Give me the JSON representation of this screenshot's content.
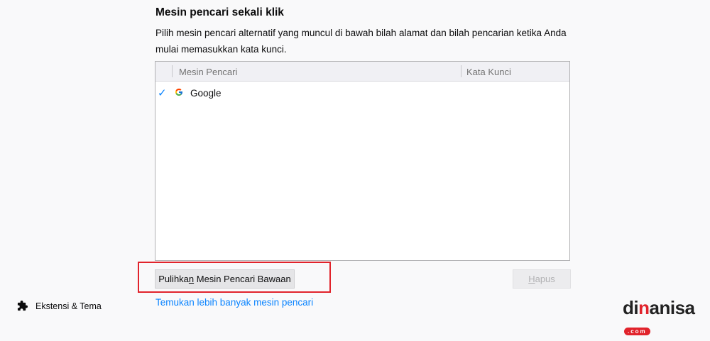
{
  "section": {
    "title": "Mesin pencari sekali klik",
    "description": "Pilih mesin pencari alternatif yang muncul di bawah bilah alamat dan bilah pencarian ketika Anda mulai memasukkan kata kunci."
  },
  "tree": {
    "columns": {
      "name": "Mesin Pencari",
      "keyword": "Kata Kunci"
    },
    "rows": [
      {
        "checked": true,
        "icon": "google-icon",
        "name": "Google",
        "keyword": ""
      }
    ]
  },
  "buttons": {
    "restore": {
      "before": "Pulihka",
      "access_key": "n",
      "after": " Mesin Pencari Bawaan"
    },
    "remove": {
      "access_key": "H",
      "after": "apus"
    }
  },
  "link": "Temukan lebih banyak mesin pencari",
  "sidebar": {
    "extensions_label": "Ekstensi & Tema",
    "icon": "puzzle-icon"
  },
  "watermark": {
    "part1": "di",
    "part2": "anisa",
    "suffix": ".com"
  },
  "colors": {
    "accent": "#0a84ff",
    "highlight": "#e1232b"
  }
}
